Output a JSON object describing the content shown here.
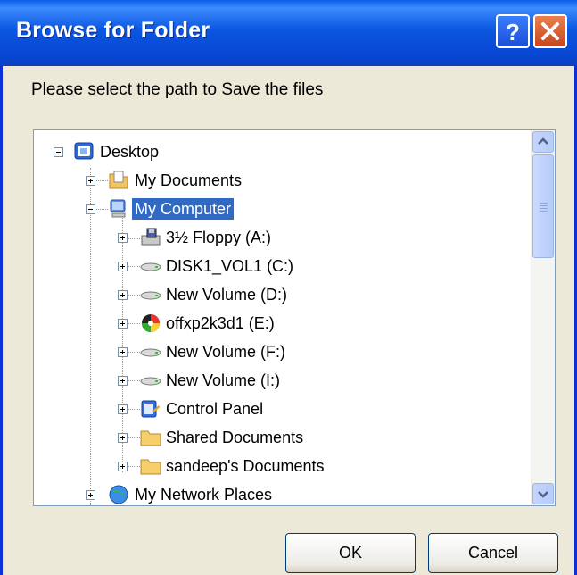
{
  "window": {
    "title": "Browse for Folder"
  },
  "titlebar_buttons": {
    "help_icon": "question-mark",
    "close_icon": "x-mark"
  },
  "prompt": "Please select the path to Save the files",
  "tree": {
    "items": [
      {
        "label": "Desktop",
        "icon": "desktop-icon",
        "expander": "minus",
        "selected": false
      },
      {
        "label": "My Documents",
        "icon": "my-documents-icon",
        "expander": "plus",
        "selected": false
      },
      {
        "label": "My Computer",
        "icon": "my-computer-icon",
        "expander": "minus",
        "selected": true
      },
      {
        "label": "3½ Floppy (A:)",
        "icon": "floppy-drive-icon",
        "expander": "plus",
        "selected": false
      },
      {
        "label": "DISK1_VOL1 (C:)",
        "icon": "hard-drive-icon",
        "expander": "plus",
        "selected": false
      },
      {
        "label": "New Volume (D:)",
        "icon": "hard-drive-icon",
        "expander": "plus",
        "selected": false
      },
      {
        "label": "offxp2k3d1 (E:)",
        "icon": "cd-drive-icon",
        "expander": "plus",
        "selected": false
      },
      {
        "label": "New Volume (F:)",
        "icon": "hard-drive-icon",
        "expander": "plus",
        "selected": false
      },
      {
        "label": "New Volume (I:)",
        "icon": "hard-drive-icon",
        "expander": "plus",
        "selected": false
      },
      {
        "label": "Control Panel",
        "icon": "control-panel-icon",
        "expander": "plus",
        "selected": false
      },
      {
        "label": "Shared Documents",
        "icon": "folder-icon",
        "expander": "plus",
        "selected": false
      },
      {
        "label": "sandeep's Documents",
        "icon": "folder-icon",
        "expander": "plus",
        "selected": false
      },
      {
        "label": "My Network Places",
        "icon": "network-places-icon",
        "expander": "plus",
        "selected": false
      }
    ]
  },
  "buttons": {
    "ok": "OK",
    "cancel": "Cancel"
  },
  "colors": {
    "titlebar": "#0b56e0",
    "selection": "#316ac5",
    "dialog_bg": "#ece9d8"
  }
}
